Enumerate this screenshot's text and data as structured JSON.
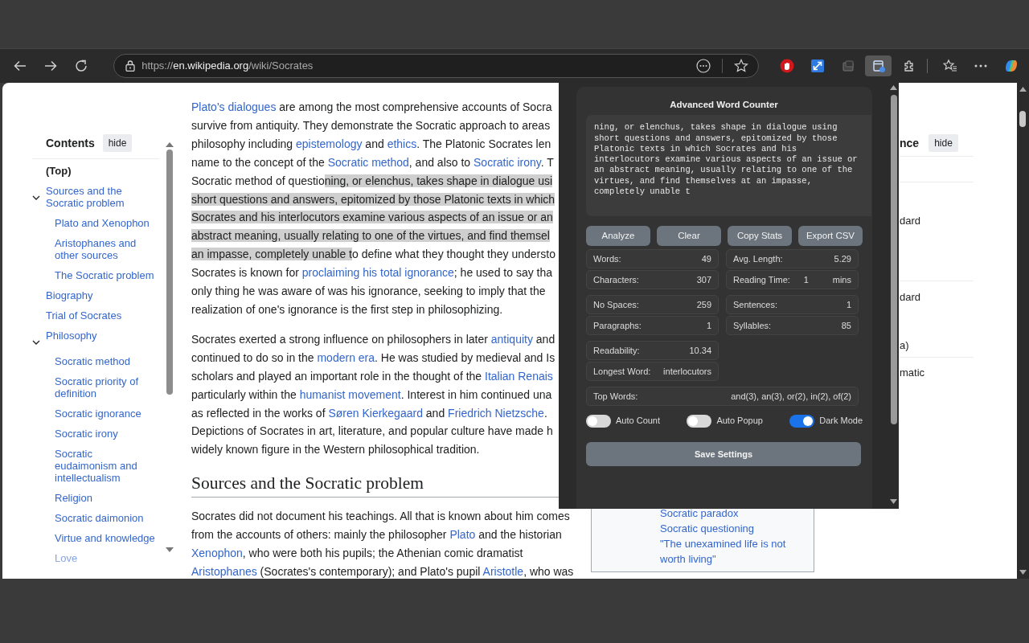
{
  "browser": {
    "url_scheme": "https://",
    "url_host": "en.wikipedia.org",
    "url_path": "/wiki/Socrates",
    "toolbar_icons": [
      {
        "kind": "hand",
        "selected": false
      },
      {
        "kind": "resize",
        "selected": false
      },
      {
        "kind": "square",
        "selected": false
      },
      {
        "kind": "window",
        "selected": true
      },
      {
        "kind": "puzzle",
        "selected": false
      },
      {
        "kind": "divider"
      },
      {
        "kind": "favorites",
        "selected": false
      },
      {
        "kind": "more",
        "selected": false
      },
      {
        "kind": "logo",
        "selected": false
      }
    ]
  },
  "toc": {
    "title": "Contents",
    "hide_label": "hide",
    "items": [
      {
        "label": "(Top)",
        "selected": true
      },
      {
        "label": "Sources and the Socratic problem",
        "selected": false,
        "expanded": true,
        "children": [
          {
            "label": "Plato and Xenophon",
            "selected": false
          },
          {
            "label": "Aristophanes and other sources",
            "selected": false
          },
          {
            "label": "The Socratic problem",
            "selected": false
          }
        ]
      },
      {
        "label": "Biography",
        "selected": false
      },
      {
        "label": "Trial of Socrates",
        "selected": false
      },
      {
        "label": "Philosophy",
        "selected": false,
        "expanded": true,
        "children": [
          {
            "label": "Socratic method",
            "selected": false
          },
          {
            "label": "Socratic priority of definition",
            "selected": false
          },
          {
            "label": "Socratic ignorance",
            "selected": false
          },
          {
            "label": "Socratic irony",
            "selected": false
          },
          {
            "label": "Socratic eudaimonism and intellectualism",
            "selected": false
          },
          {
            "label": "Religion",
            "selected": false
          },
          {
            "label": "Socratic daimonion",
            "selected": false
          },
          {
            "label": "Virtue and knowledge",
            "selected": false
          },
          {
            "label": "Love",
            "selected": false
          }
        ]
      }
    ]
  },
  "article": [
    {
      "kind": "paragraph",
      "lines": [
        [
          {
            "text": "Plato's dialogues",
            "link": true
          },
          {
            "text": " are among the most comprehensive accounts of Socra"
          }
        ],
        [
          {
            "text": "survive from antiquity. They demonstrate the Socratic approach to areas"
          }
        ],
        [
          {
            "text": "philosophy including "
          },
          {
            "text": "epistemology",
            "link": true
          },
          {
            "text": " and "
          },
          {
            "text": "ethics",
            "link": true
          },
          {
            "text": ". The Platonic Socrates len"
          }
        ],
        [
          {
            "text": "name to the concept of the "
          },
          {
            "text": "Socratic method",
            "link": true
          },
          {
            "text": ", and also to "
          },
          {
            "text": "Socratic irony",
            "link": true
          },
          {
            "text": ". T"
          }
        ],
        [
          {
            "text": "Socratic method of questio"
          },
          {
            "text": "ning, or elenchus, takes shape in dialogue usi",
            "highlighted": true
          }
        ],
        [
          {
            "text": "short questions and answers, epitomized by those Platonic texts in which",
            "highlighted": true
          }
        ],
        [
          {
            "text": "Socrates and his interlocutors examine various aspects of an issue or an",
            "highlighted": true
          }
        ],
        [
          {
            "text": "abstract meaning, usually relating to one of the virtues, and find themsel",
            "highlighted": true
          }
        ],
        [
          {
            "text": "an impasse, completely unable t",
            "highlighted": true
          },
          {
            "text": "o define what they thought they understo"
          }
        ],
        [
          {
            "text": "Socrates is known for "
          },
          {
            "text": "proclaiming his total ignorance",
            "link": true
          },
          {
            "text": "; he used to say tha"
          }
        ],
        [
          {
            "text": "only thing he was aware of was his ignorance, seeking to imply that the"
          }
        ],
        [
          {
            "text": "realization of one's ignorance is the first step in philosophizing."
          }
        ]
      ]
    },
    {
      "kind": "paragraph",
      "lines": [
        [
          {
            "text": "Socrates exerted a strong influence on philosophers in later "
          },
          {
            "text": "antiquity",
            "link": true
          },
          {
            "text": " and"
          }
        ],
        [
          {
            "text": "continued to do so in the "
          },
          {
            "text": "modern era",
            "link": true
          },
          {
            "text": ". He was studied by medieval and Is"
          }
        ],
        [
          {
            "text": "scholars and played an important role in the thought of the "
          },
          {
            "text": "Italian Renais",
            "link": true
          }
        ],
        [
          {
            "text": "particularly within the "
          },
          {
            "text": "humanist movement",
            "link": true
          },
          {
            "text": ". Interest in him continued una"
          }
        ],
        [
          {
            "text": "as reflected in the works of "
          },
          {
            "text": "Søren Kierkegaard",
            "link": true
          },
          {
            "text": " and "
          },
          {
            "text": "Friedrich Nietzsche",
            "link": true
          },
          {
            "text": "."
          }
        ],
        [
          {
            "text": "Depictions of Socrates in art, literature, and popular culture have made h"
          }
        ],
        [
          {
            "text": "widely known figure in the Western philosophical tradition."
          }
        ]
      ]
    },
    {
      "kind": "heading",
      "text": "Sources and the Socratic problem"
    },
    {
      "kind": "paragraph",
      "lines": [
        [
          {
            "text": "Socrates did not document his teachings. All that is known about him comes"
          }
        ],
        [
          {
            "text": "from the accounts of others: mainly the philosopher "
          },
          {
            "text": "Plato",
            "link": true
          },
          {
            "text": " and the historian"
          }
        ],
        [
          {
            "text": "Xenophon",
            "link": true
          },
          {
            "text": ", who were both his pupils; the Athenian comic dramatist"
          }
        ],
        [
          {
            "text": "Aristophanes",
            "link": true
          },
          {
            "text": " (Socrates's contemporary); and Plato's pupil "
          },
          {
            "text": "Aristotle",
            "link": true
          },
          {
            "text": ", who was"
          }
        ]
      ]
    }
  ],
  "infobox": {
    "links": [
      "Socratic paradox",
      "Socratic questioning",
      "\"The unexamined life is not worth living\""
    ]
  },
  "appearance": {
    "title": "nce",
    "hide_label": "hide",
    "fragments": [
      "dard",
      "dard",
      "a)",
      "matic"
    ]
  },
  "popup": {
    "title": "Advanced Word Counter",
    "text": "ning, or elenchus, takes shape in dialogue using short questions and answers, epitomized by those Platonic texts in which Socrates and his interlocutors examine various aspects of an issue or an abstract meaning, usually relating to one of the virtues, and find themselves at an impasse, completely unable t",
    "buttons": [
      "Analyze",
      "Clear",
      "Copy Stats",
      "Export CSV"
    ],
    "stat_groups": [
      {
        "columns": [
          [
            {
              "label": "Words:",
              "value": "49"
            },
            {
              "label": "Characters:",
              "value": "307"
            }
          ],
          [
            {
              "label": "Avg. Length:",
              "value": "5.29"
            },
            {
              "label": "Reading Time:",
              "value": "1",
              "unit": "mins"
            }
          ]
        ]
      },
      {
        "columns": [
          [
            {
              "label": "No Spaces:",
              "value": "259"
            },
            {
              "label": "Paragraphs:",
              "value": "1"
            }
          ],
          [
            {
              "label": "Sentences:",
              "value": "1"
            },
            {
              "label": "Syllables:",
              "value": "85"
            }
          ]
        ]
      },
      {
        "columns": [
          [
            {
              "label": "Readability:",
              "value": "10.34"
            },
            {
              "label": "Longest Word:",
              "value": "interlocutors"
            }
          ]
        ]
      }
    ],
    "top_words": {
      "label": "Top Words:",
      "value": "and(3), an(3), or(2), in(2), of(2)"
    },
    "settings": [
      {
        "label": "Auto Count",
        "on": false
      },
      {
        "label": "Auto Popup",
        "on": false
      },
      {
        "label": "Dark Mode",
        "on": true
      }
    ],
    "save_label": "Save Settings"
  }
}
